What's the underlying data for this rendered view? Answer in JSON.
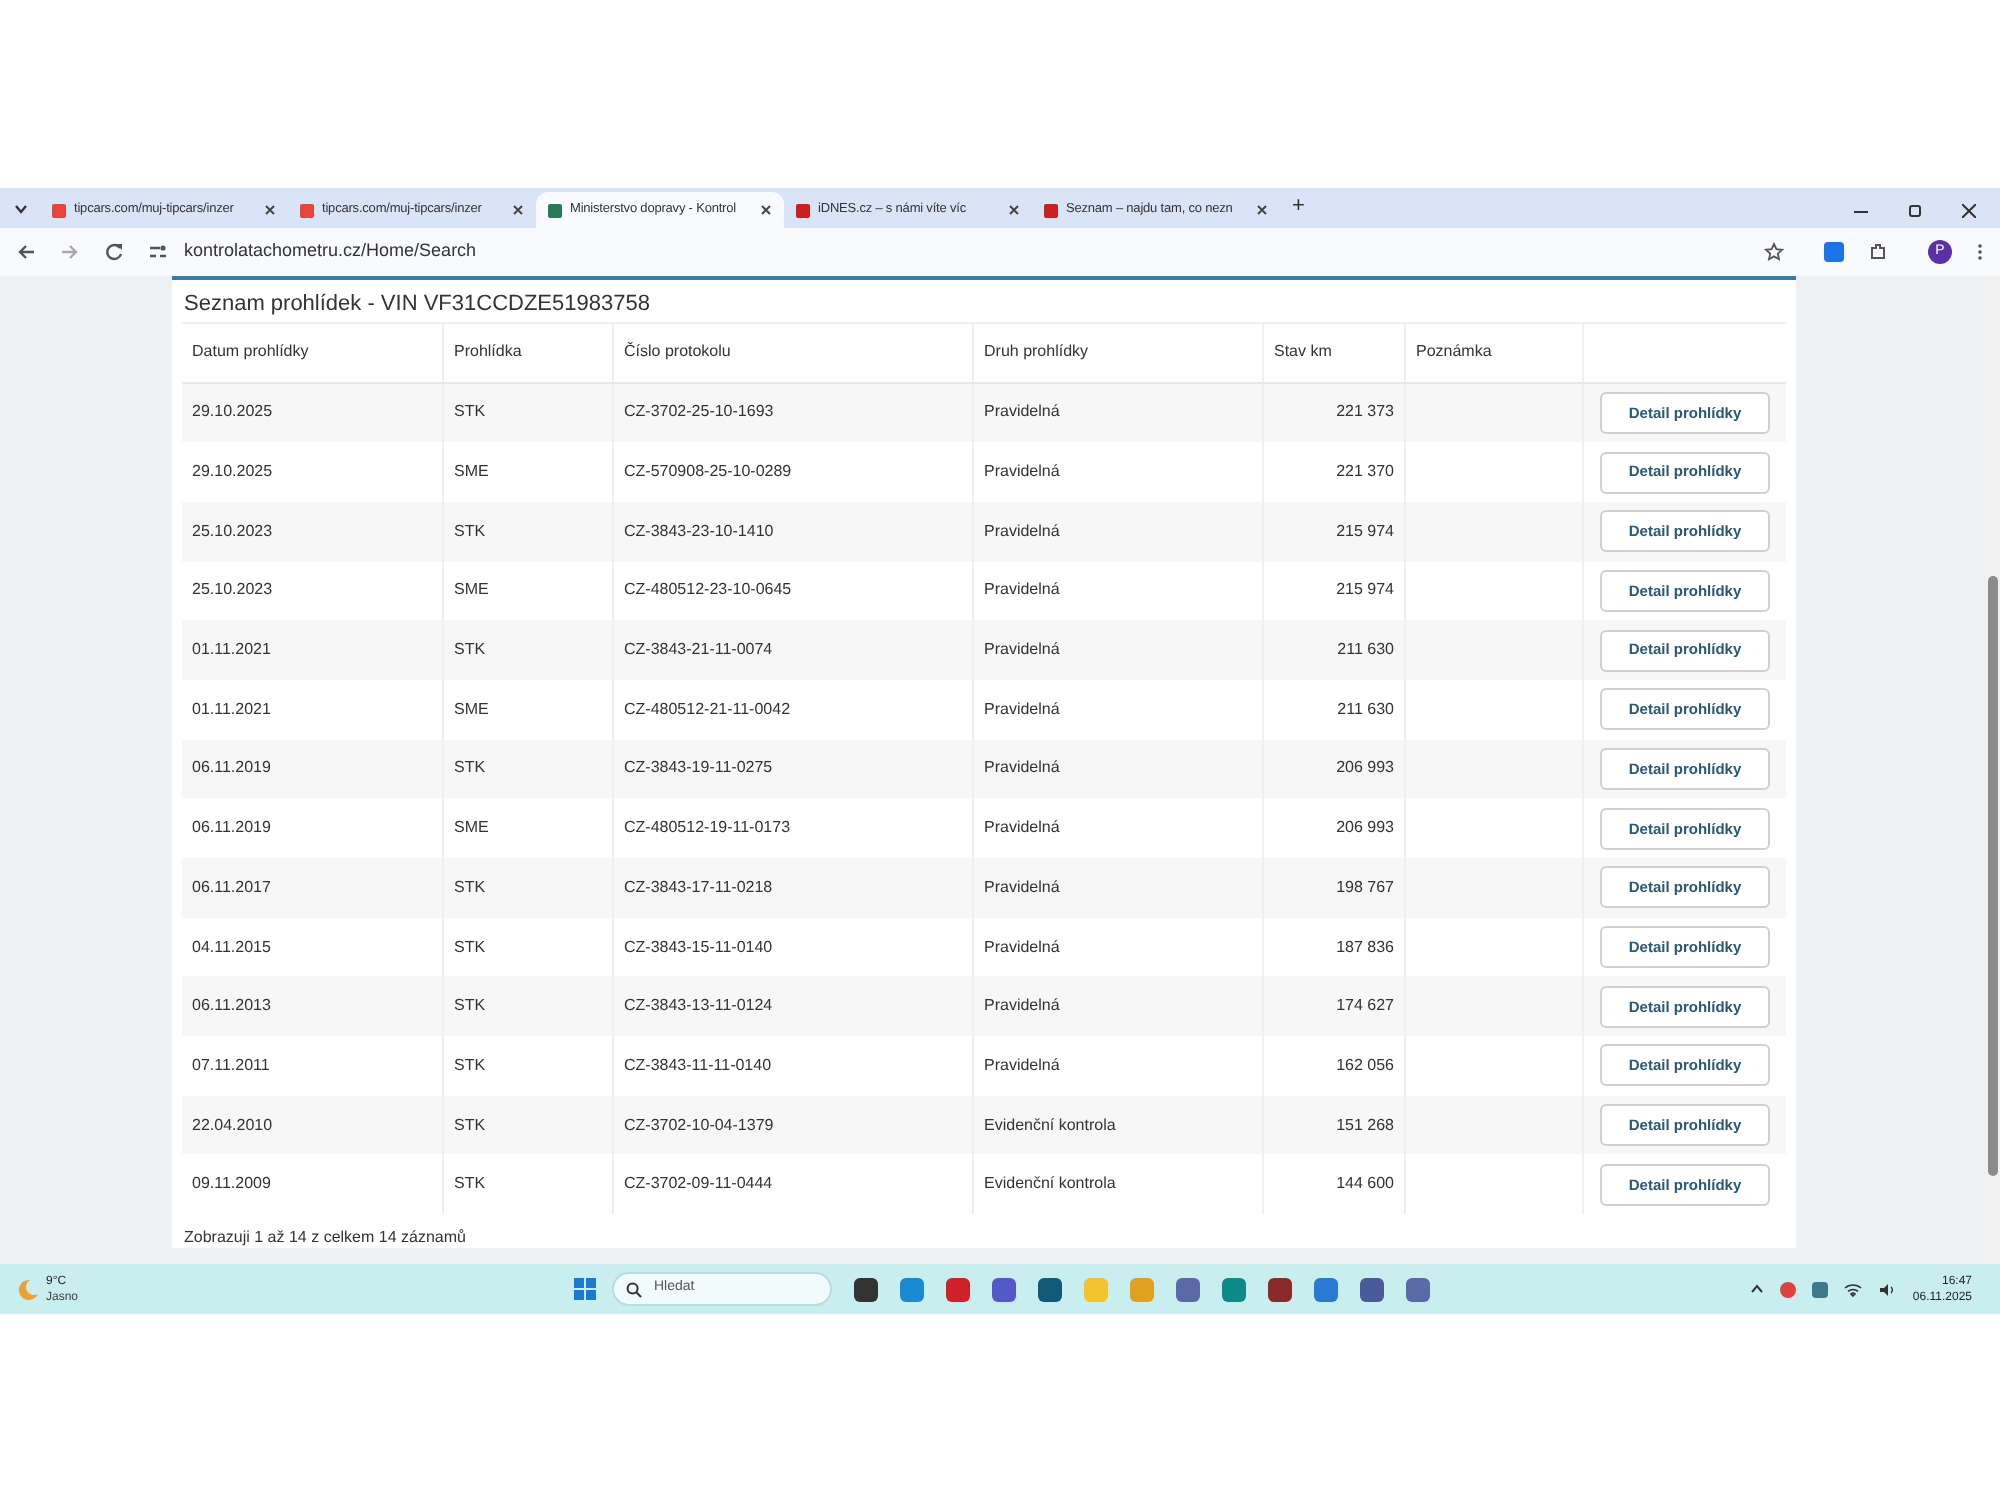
{
  "browser": {
    "tabs": [
      {
        "title": "tipcars.com/muj-tipcars/inzer",
        "selected": false
      },
      {
        "title": "tipcars.com/muj-tipcars/inzer",
        "selected": false
      },
      {
        "title": "Ministerstvo dopravy - Kontrol",
        "selected": true
      },
      {
        "title": "iDNES.cz – s námi víte víc",
        "selected": false
      },
      {
        "title": "Seznam – najdu tam, co nezn",
        "selected": false
      }
    ],
    "new_tab": "+",
    "url": "kontrolatachometru.cz/Home/Search",
    "profile": "P"
  },
  "panel": {
    "title": "Seznam prohlídek - VIN VF31CCDZE51983758",
    "columns": [
      "Datum prohlídky",
      "Prohlídka",
      "Číslo protokolu",
      "Druh prohlídky",
      "Stav km",
      "Poznámka"
    ],
    "rows": [
      {
        "date": "29.10.2025",
        "type": "STK",
        "protocol": "CZ-3702-25-10-1693",
        "kind": "Pravidelná",
        "km": "221 373",
        "action": "Detail prohlídky"
      },
      {
        "date": "29.10.2025",
        "type": "SME",
        "protocol": "CZ-570908-25-10-0289",
        "kind": "Pravidelná",
        "km": "221 370",
        "action": "Detail prohlídky"
      },
      {
        "date": "25.10.2023",
        "type": "STK",
        "protocol": "CZ-3843-23-10-1410",
        "kind": "Pravidelná",
        "km": "215 974",
        "action": "Detail prohlídky"
      },
      {
        "date": "25.10.2023",
        "type": "SME",
        "protocol": "CZ-480512-23-10-0645",
        "kind": "Pravidelná",
        "km": "215 974",
        "action": "Detail prohlídky"
      },
      {
        "date": "01.11.2021",
        "type": "STK",
        "protocol": "CZ-3843-21-11-0074",
        "kind": "Pravidelná",
        "km": "211 630",
        "action": "Detail prohlídky"
      },
      {
        "date": "01.11.2021",
        "type": "SME",
        "protocol": "CZ-480512-21-11-0042",
        "kind": "Pravidelná",
        "km": "211 630",
        "action": "Detail prohlídky"
      },
      {
        "date": "06.11.2019",
        "type": "STK",
        "protocol": "CZ-3843-19-11-0275",
        "kind": "Pravidelná",
        "km": "206 993",
        "action": "Detail prohlídky"
      },
      {
        "date": "06.11.2019",
        "type": "SME",
        "protocol": "CZ-480512-19-11-0173",
        "kind": "Pravidelná",
        "km": "206 993",
        "action": "Detail prohlídky"
      },
      {
        "date": "06.11.2017",
        "type": "STK",
        "protocol": "CZ-3843-17-11-0218",
        "kind": "Pravidelná",
        "km": "198 767",
        "action": "Detail prohlídky"
      },
      {
        "date": "04.11.2015",
        "type": "STK",
        "protocol": "CZ-3843-15-11-0140",
        "kind": "Pravidelná",
        "km": "187 836",
        "action": "Detail prohlídky"
      },
      {
        "date": "06.11.2013",
        "type": "STK",
        "protocol": "CZ-3843-13-11-0124",
        "kind": "Pravidelná",
        "km": "174 627",
        "action": "Detail prohlídky"
      },
      {
        "date": "07.11.2011",
        "type": "STK",
        "protocol": "CZ-3843-11-11-0140",
        "kind": "Pravidelná",
        "km": "162 056",
        "action": "Detail prohlídky"
      },
      {
        "date": "22.04.2010",
        "type": "STK",
        "protocol": "CZ-3702-10-04-1379",
        "kind": "Evidenční kontrola",
        "km": "151 268",
        "action": "Detail prohlídky"
      },
      {
        "date": "09.11.2009",
        "type": "STK",
        "protocol": "CZ-3702-09-11-0444",
        "kind": "Evidenční kontrola",
        "km": "144 600",
        "action": "Detail prohlídky"
      }
    ],
    "footer": "Zobrazuji 1 až 14 z celkem 14 záznamů"
  },
  "taskbar": {
    "temperature": "9°C",
    "weather": "Jasno",
    "search_placeholder": "Hledat",
    "time": "16:47",
    "date": "06.11.2025"
  }
}
